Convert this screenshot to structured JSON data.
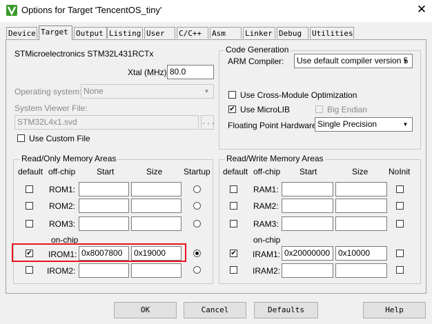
{
  "window": {
    "title": "Options for Target 'TencentOS_tiny'",
    "icon": "keil-uvision-icon",
    "close_glyph": "✕"
  },
  "tabs": [
    "Device",
    "Target",
    "Output",
    "Listing",
    "User",
    "C/C++",
    "Asm",
    "Linker",
    "Debug",
    "Utilities"
  ],
  "active_tab": "Target",
  "device_name": "STMicroelectronics STM32L431RCTx",
  "xtal": {
    "label": "Xtal (MHz):",
    "value": "80.0"
  },
  "os": {
    "label": "Operating system:",
    "value": "None"
  },
  "svd": {
    "label": "System Viewer File:",
    "value": "STM32L4x1.svd",
    "browse": "..."
  },
  "custom_file": {
    "label": "Use Custom File",
    "checked": false
  },
  "codegen": {
    "group_label": "Code Generation",
    "compiler_label": "ARM Compiler:",
    "compiler_value": "Use default compiler version 5",
    "cross_module": {
      "label": "Use Cross-Module Optimization",
      "checked": false
    },
    "microlib": {
      "label": "Use MicroLIB",
      "checked": true
    },
    "big_endian": {
      "label": "Big Endian",
      "checked": false
    },
    "fp_label": "Floating Point Hardware:",
    "fp_value": "Single Precision"
  },
  "ro_memory": {
    "group_label": "Read/Only Memory Areas",
    "headers": {
      "default": "default",
      "offchip": "off-chip",
      "start": "Start",
      "size": "Size",
      "startup": "Startup"
    },
    "onchip_label": "on-chip",
    "rows": [
      {
        "name": "ROM1:",
        "start": "",
        "size": "",
        "default": false,
        "startup": false
      },
      {
        "name": "ROM2:",
        "start": "",
        "size": "",
        "default": false,
        "startup": false
      },
      {
        "name": "ROM3:",
        "start": "",
        "size": "",
        "default": false,
        "startup": false
      },
      {
        "name": "IROM1:",
        "start": "0x8007800",
        "size": "0x19000",
        "default": true,
        "startup": true
      },
      {
        "name": "IROM2:",
        "start": "",
        "size": "",
        "default": false,
        "startup": false
      }
    ]
  },
  "rw_memory": {
    "group_label": "Read/Write Memory Areas",
    "headers": {
      "default": "default",
      "offchip": "off-chip",
      "start": "Start",
      "size": "Size",
      "noinit": "NoInit"
    },
    "onchip_label": "on-chip",
    "rows": [
      {
        "name": "RAM1:",
        "start": "",
        "size": "",
        "default": false,
        "noinit": false
      },
      {
        "name": "RAM2:",
        "start": "",
        "size": "",
        "default": false,
        "noinit": false
      },
      {
        "name": "RAM3:",
        "start": "",
        "size": "",
        "default": false,
        "noinit": false
      },
      {
        "name": "IRAM1:",
        "start": "0x20000000",
        "size": "0x10000",
        "default": true,
        "noinit": false
      },
      {
        "name": "IRAM2:",
        "start": "",
        "size": "",
        "default": false,
        "noinit": false
      }
    ]
  },
  "buttons": {
    "ok": "OK",
    "cancel": "Cancel",
    "defaults": "Defaults",
    "help": "Help"
  },
  "colors": {
    "highlight": "#e8131f",
    "app_icon": "#3a9a2a"
  }
}
